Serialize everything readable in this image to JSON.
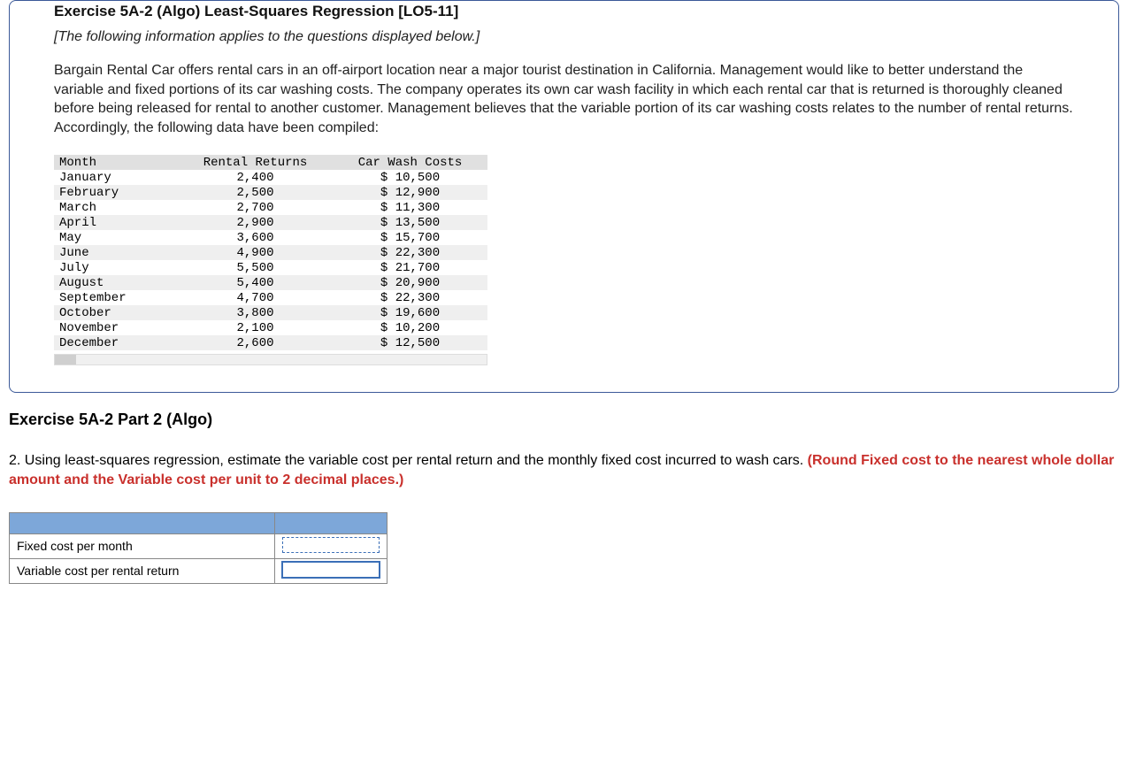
{
  "problem": {
    "title": "Exercise 5A-2 (Algo) Least-Squares Regression [LO5-11]",
    "preface": "[The following information applies to the questions displayed below.]",
    "body": "Bargain Rental Car offers rental cars in an off-airport location near a major tourist destination in California. Management would like to better understand the variable and fixed portions of its car washing costs. The company operates its own car wash facility in which each rental car that is returned is thoroughly cleaned before being released for rental to another customer. Management believes that the variable portion of its car washing costs relates to the number of rental returns. Accordingly, the following data have been compiled:",
    "table": {
      "headers": {
        "month": "Month",
        "returns": "Rental Returns",
        "cost": "Car Wash Costs"
      },
      "rows": [
        {
          "month": "January",
          "returns": "2,400",
          "cost": "$ 10,500"
        },
        {
          "month": "February",
          "returns": "2,500",
          "cost": "$ 12,900"
        },
        {
          "month": "March",
          "returns": "2,700",
          "cost": "$ 11,300"
        },
        {
          "month": "April",
          "returns": "2,900",
          "cost": "$ 13,500"
        },
        {
          "month": "May",
          "returns": "3,600",
          "cost": "$ 15,700"
        },
        {
          "month": "June",
          "returns": "4,900",
          "cost": "$ 22,300"
        },
        {
          "month": "July",
          "returns": "5,500",
          "cost": "$ 21,700"
        },
        {
          "month": "August",
          "returns": "5,400",
          "cost": "$ 20,900"
        },
        {
          "month": "September",
          "returns": "4,700",
          "cost": "$ 22,300"
        },
        {
          "month": "October",
          "returns": "3,800",
          "cost": "$ 19,600"
        },
        {
          "month": "November",
          "returns": "2,100",
          "cost": "$ 10,200"
        },
        {
          "month": "December",
          "returns": "2,600",
          "cost": "$ 12,500"
        }
      ]
    }
  },
  "part2": {
    "header": "Exercise 5A-2 Part 2 (Algo)",
    "question_lead": "2. Using least-squares regression, estimate the variable cost per rental return and the monthly fixed cost incurred to wash cars. ",
    "question_red": "(Round Fixed cost to the nearest whole dollar amount and the Variable cost per unit to 2 decimal places.)",
    "answer_labels": {
      "fixed": "Fixed cost per month",
      "variable": "Variable cost per rental return"
    }
  }
}
